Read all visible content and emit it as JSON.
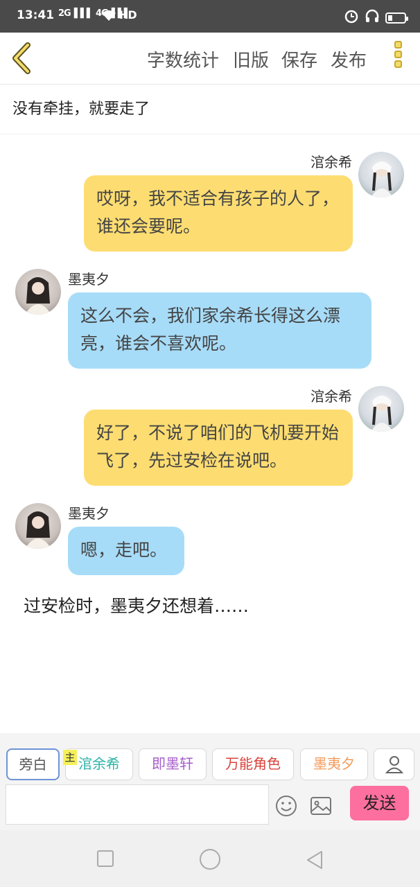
{
  "status_bar": {
    "time": "13:41",
    "signal_1": "2G",
    "signal_2": "4G",
    "network": "HD",
    "icons": [
      "alarm-icon",
      "headset-icon",
      "battery-icon"
    ]
  },
  "toolbar": {
    "word_count": "字数统计",
    "old_version": "旧版",
    "save": "保存",
    "publish": "发布"
  },
  "chapter": {
    "title": "没有牵挂，就要走了"
  },
  "messages": [
    {
      "side": "right",
      "name": "涫余希",
      "text": "哎呀，我不适合有孩子的人了，谁还会要呢。",
      "color": "#fddd72"
    },
    {
      "side": "left",
      "name": "墨夷夕",
      "text": "这么不会，我们家余希长得这么漂亮，谁会不喜欢呢。",
      "color": "#a7dcf8"
    },
    {
      "side": "right",
      "name": "涫余希",
      "text": "好了，不说了咱们的飞机要开始飞了，先过安检在说吧。",
      "color": "#fddd72"
    },
    {
      "side": "left",
      "name": "墨夷夕",
      "text": "嗯，走吧。",
      "color": "#a7dcf8"
    }
  ],
  "narration": "过安检时，墨夷夕还想着……",
  "roles": [
    {
      "label": "旁白",
      "color": "#555555",
      "selected": true
    },
    {
      "label": "涫余希",
      "color": "#2fb3a8",
      "badge": "主"
    },
    {
      "label": "即墨轩",
      "color": "#a45cc8"
    },
    {
      "label": "万能角色",
      "color": "#d9433c"
    },
    {
      "label": "墨夷夕",
      "color": "#f39a5b"
    }
  ],
  "input": {
    "value": "",
    "placeholder": ""
  },
  "send_label": "发送"
}
